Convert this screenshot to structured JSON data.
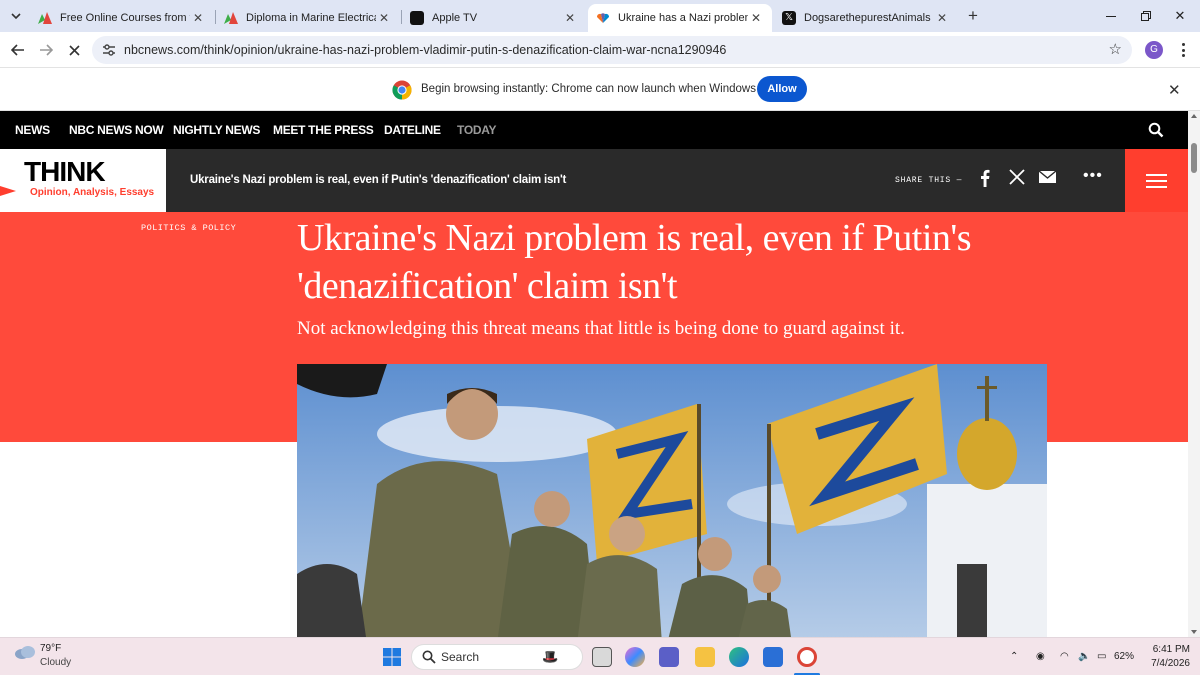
{
  "browser": {
    "tabs": [
      {
        "title": "Free Online Courses from the W",
        "favicon": "alison-icon",
        "active": false
      },
      {
        "title": "Diploma in Marine Electrical: Re",
        "favicon": "alison-icon",
        "active": false
      },
      {
        "title": "Apple TV",
        "favicon": "apple-tv-icon",
        "active": false
      },
      {
        "title": "Ukraine has a Nazi problem, bu",
        "favicon": "nbc-peacock-icon",
        "active": true
      },
      {
        "title": "DogsarethepurestAnimals on X",
        "favicon": "x-icon",
        "active": false
      }
    ],
    "url": "nbcnews.com/think/opinion/ukraine-has-nazi-problem-vladimir-putin-s-denazification-claim-war-ncna1290946",
    "profile_initial": "G",
    "infobar": {
      "message": "Begin browsing instantly: Chrome can now launch when Windows starts.",
      "allow_label": "Allow"
    }
  },
  "site": {
    "nav": [
      "NEWS",
      "NBC NEWS NOW",
      "NIGHTLY NEWS",
      "MEET THE PRESS",
      "DATELINE",
      "TODAY"
    ],
    "think": {
      "logo_word": "THINK",
      "logo_sub": "Opinion, Analysis, Essays",
      "headline": "Ukraine's Nazi problem is real, even if Putin's 'denazification' claim isn't",
      "share_label": "SHARE THIS —",
      "share_icons": [
        "facebook-icon",
        "x-icon",
        "email-icon",
        "more-icon"
      ]
    },
    "article": {
      "section": "POLITICS & POLICY",
      "title": "Ukraine's Nazi problem is real, even if Putin's 'denazification' claim isn't",
      "dek": "Not acknowledging this threat means that little is being done to guard against it."
    },
    "colors": {
      "accent": "#ff4a3b",
      "nav_bg": "#000000",
      "think_bar": "#2a2a2a"
    }
  },
  "taskbar": {
    "weather": {
      "temp": "79°F",
      "condition": "Cloudy"
    },
    "search_label": "Search",
    "battery": "62%",
    "time": "6:41 PM",
    "date": "7/4/2026"
  }
}
